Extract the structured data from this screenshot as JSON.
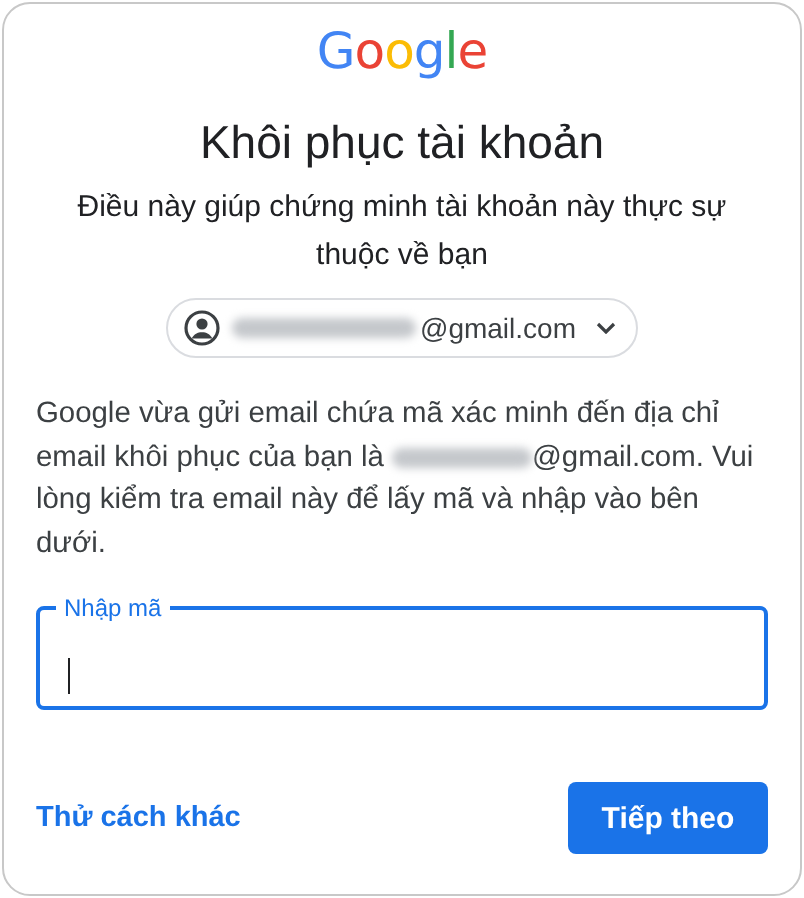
{
  "logo": "Google",
  "title": "Khôi phục tài khoản",
  "subtitle": "Điều này giúp chứng minh tài khoản này thực sự thuộc về bạn",
  "account": {
    "redacted": true,
    "email_suffix": "@gmail.com"
  },
  "message": {
    "before": "Google vừa gửi email chứa mã xác minh đến địa chỉ email khôi phục của bạn là",
    "redacted": true,
    "after": "@gmail.com. Vui lòng kiểm tra email này để lấy mã và nhập vào bên dưới."
  },
  "code_field": {
    "label": "Nhập mã",
    "focused": true
  },
  "other_way_link": "Thử cách khác",
  "next_button": "Tiếp theo"
}
